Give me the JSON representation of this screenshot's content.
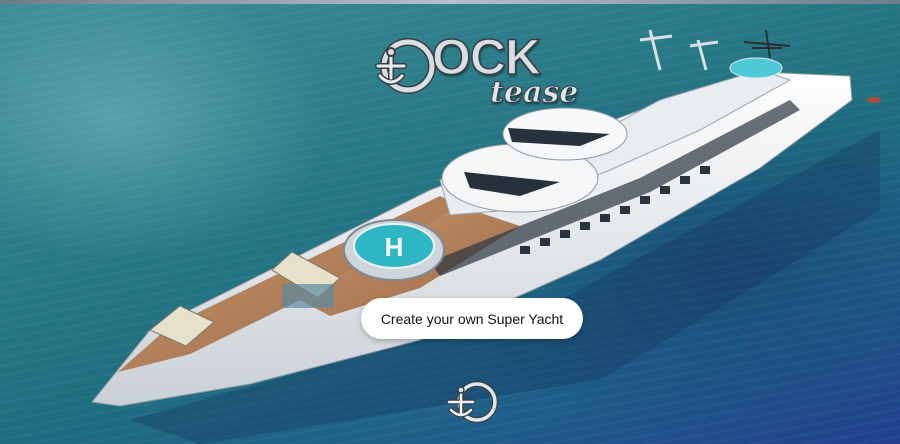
{
  "brand": {
    "logo_main": "OCK",
    "logo_sub": "tease"
  },
  "hero": {
    "cta_label": "Create your own Super Yacht"
  },
  "icons": {
    "logo_anchor": "anchor-icon",
    "bottom_anchor": "anchor-icon",
    "helipad": "helipad-icon"
  },
  "colors": {
    "sea_light": "#3f8d98",
    "sea_deep": "#223f8c",
    "hull": "#f2f4f6",
    "deck": "#b8835a",
    "helipad": "#2fb6c4",
    "button_bg": "#ffffff",
    "button_text": "#111111"
  }
}
